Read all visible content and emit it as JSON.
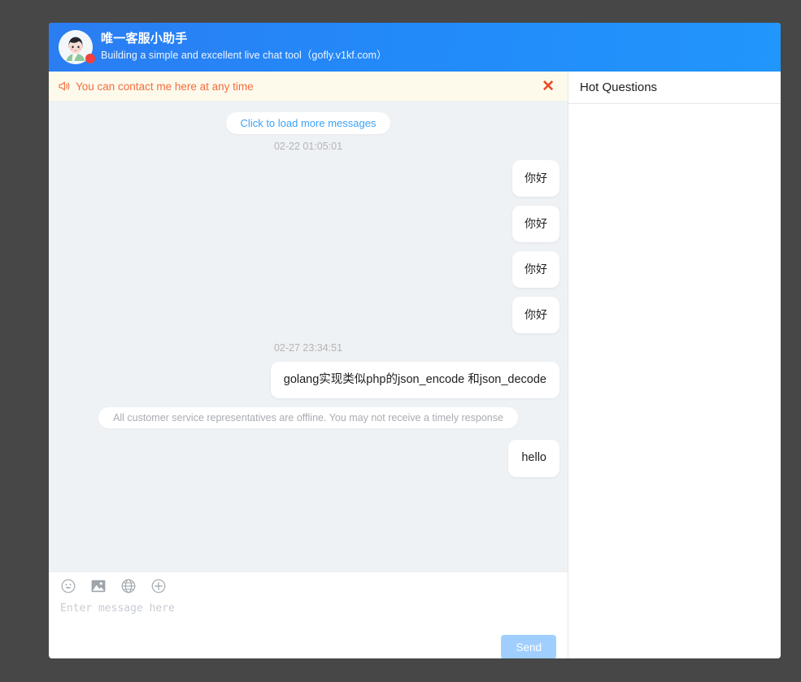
{
  "header": {
    "title": "唯一客服小助手",
    "subtitle": "Building a simple and excellent live chat tool（gofly.v1kf.com）",
    "avatar_name": "agent-avatar",
    "status": "offline"
  },
  "notice": {
    "icon": "megaphone-icon",
    "text": "You can contact me here at any time",
    "close_label": "✕"
  },
  "hot_questions": {
    "title": "Hot Questions",
    "items": []
  },
  "messages": {
    "load_more_label": "Click to load more messages",
    "items": [
      {
        "type": "time",
        "text": "02-22 01:05:01"
      },
      {
        "type": "out",
        "text": "你好"
      },
      {
        "type": "out",
        "text": "你好"
      },
      {
        "type": "out",
        "text": "你好"
      },
      {
        "type": "out",
        "text": "你好"
      },
      {
        "type": "time",
        "text": "02-27 23:34:51"
      },
      {
        "type": "out",
        "text": "golang实现类似php的json_encode 和json_decode"
      },
      {
        "type": "system",
        "text": "All customer service representatives are offline. You may not receive a timely response"
      },
      {
        "type": "out",
        "text": "hello"
      }
    ]
  },
  "composer": {
    "tools": [
      {
        "name": "emoji-icon",
        "label": "Emoji"
      },
      {
        "name": "image-icon",
        "label": "Image"
      },
      {
        "name": "globe-icon",
        "label": "Link"
      },
      {
        "name": "plus-circle-icon",
        "label": "More"
      }
    ],
    "input_value": "",
    "input_placeholder": "Enter message here",
    "send_label": "Send"
  },
  "colors": {
    "header_start": "#2b7df2",
    "header_end": "#2196fb",
    "notice_bg": "#fdfaec",
    "notice_fg": "#f56c3c",
    "chat_bg": "#eff2f5",
    "send_disabled": "#a0cfff",
    "page_bg": "#474747",
    "status_dot": "#f04040"
  }
}
